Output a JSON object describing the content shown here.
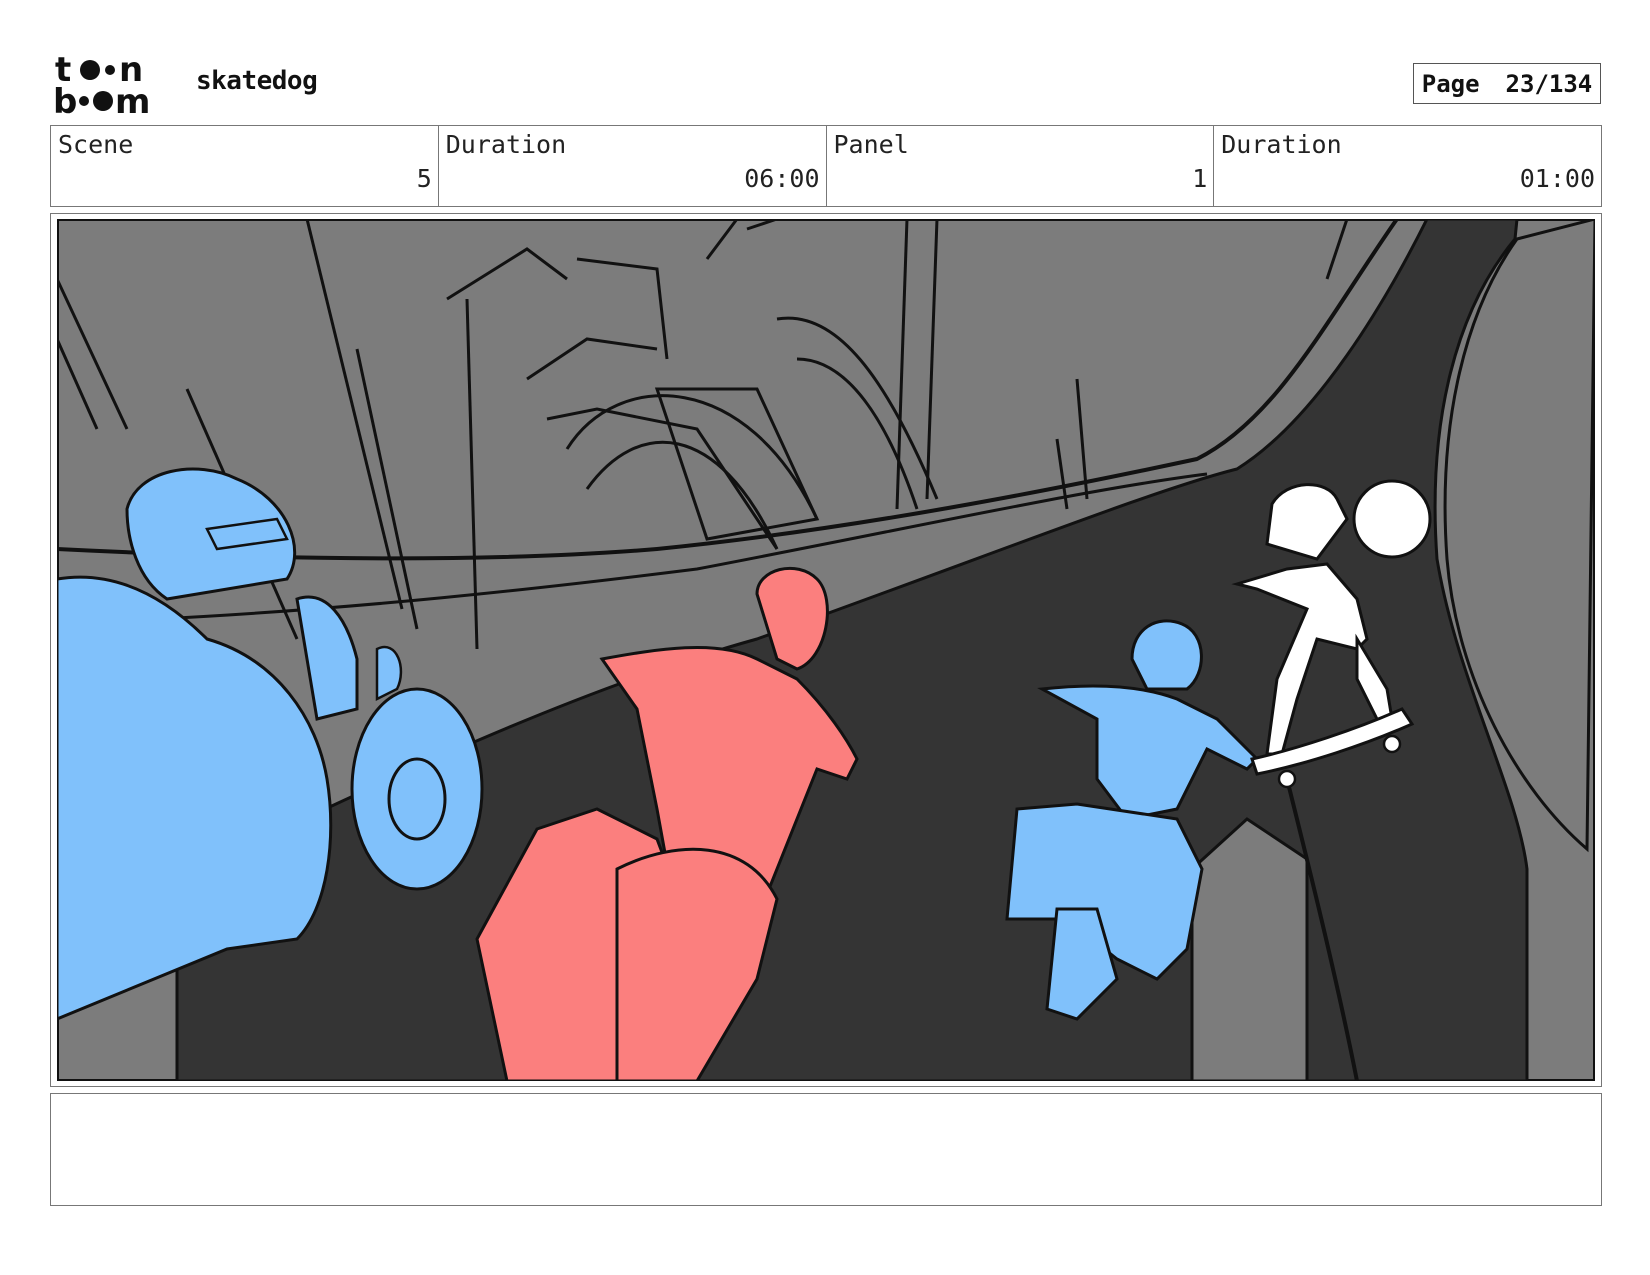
{
  "header": {
    "logo_alt": "toon boom",
    "project_title": "skatedog",
    "page_label": "Page",
    "page_number": "23/134"
  },
  "info": {
    "scene_label": "Scene",
    "scene_value": "5",
    "scene_duration_label": "Duration",
    "scene_duration_value": "06:00",
    "panel_label": "Panel",
    "panel_value": "1",
    "panel_duration_label": "Duration",
    "panel_duration_value": "01:00"
  },
  "notes": {
    "text": ""
  },
  "colors": {
    "sky_building": "#7c7c7c",
    "road": "#343434",
    "rider_blue": "#80c1fb",
    "rider_red": "#fb7f7e",
    "ink": "#111111"
  }
}
